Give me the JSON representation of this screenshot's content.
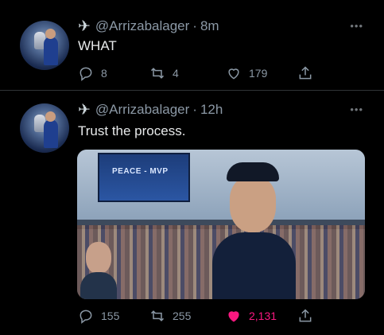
{
  "tweets": [
    {
      "handle": "@Arrizabalager",
      "time": "8m",
      "text": "WHAT",
      "replies": "8",
      "retweets": "4",
      "likes": "179",
      "liked": false
    },
    {
      "handle": "@Arrizabalager",
      "time": "12h",
      "text": "Trust the process.",
      "media_screen_text": "PEACE - MVP",
      "replies": "155",
      "retweets": "255",
      "likes": "2,131",
      "liked": true
    }
  ],
  "colors": {
    "background": "#000000",
    "text": "#e7e9ea",
    "muted": "#8b98a5",
    "like_active": "#f91880"
  },
  "icons": [
    "airplane-icon",
    "more-icon",
    "reply-icon",
    "retweet-icon",
    "like-icon",
    "share-icon"
  ],
  "dot": "·"
}
